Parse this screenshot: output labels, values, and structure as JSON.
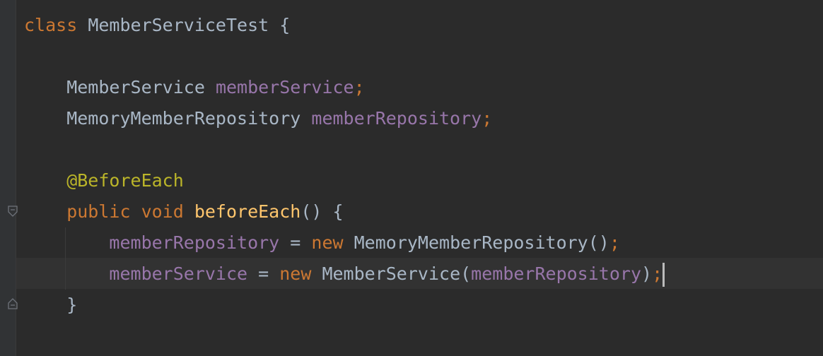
{
  "editor": {
    "lines": [
      {
        "tokens": [
          {
            "t": "class",
            "c": "kw"
          },
          {
            "t": " MemberServiceTest {",
            "c": "plain"
          }
        ]
      },
      {
        "tokens": []
      },
      {
        "tokens": [
          {
            "t": "    MemberService ",
            "c": "plain"
          },
          {
            "t": "memberService",
            "c": "field"
          },
          {
            "t": ";",
            "c": "punct"
          }
        ]
      },
      {
        "tokens": [
          {
            "t": "    MemoryMemberRepository ",
            "c": "plain"
          },
          {
            "t": "memberRepository",
            "c": "field"
          },
          {
            "t": ";",
            "c": "punct"
          }
        ]
      },
      {
        "tokens": []
      },
      {
        "tokens": [
          {
            "t": "    @BeforeEach",
            "c": "ann"
          }
        ]
      },
      {
        "tokens": [
          {
            "t": "    public void ",
            "c": "kw"
          },
          {
            "t": "beforeEach",
            "c": "method"
          },
          {
            "t": "() {",
            "c": "plain"
          }
        ]
      },
      {
        "tokens": [
          {
            "t": "        memberRepository",
            "c": "field"
          },
          {
            "t": " = ",
            "c": "plain"
          },
          {
            "t": "new ",
            "c": "kw"
          },
          {
            "t": "MemoryMemberRepository()",
            "c": "plain"
          },
          {
            "t": ";",
            "c": "punct"
          }
        ]
      },
      {
        "tokens": [
          {
            "t": "        memberService",
            "c": "field"
          },
          {
            "t": " = ",
            "c": "plain"
          },
          {
            "t": "new ",
            "c": "kw"
          },
          {
            "t": "MemberService(",
            "c": "plain"
          },
          {
            "t": "memberRepository",
            "c": "field"
          },
          {
            "t": ")",
            "c": "plain"
          },
          {
            "t": ";",
            "c": "punct"
          }
        ],
        "caret": true
      },
      {
        "tokens": [
          {
            "t": "    }",
            "c": "plain"
          }
        ]
      }
    ]
  },
  "gutter": {
    "fold_markers": [
      "fold-open-icon",
      "fold-close-icon"
    ]
  }
}
